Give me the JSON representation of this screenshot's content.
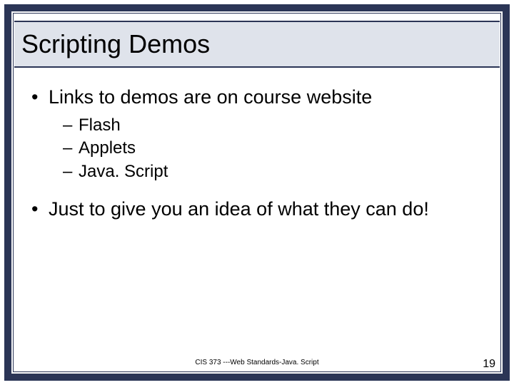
{
  "slide": {
    "title": "Scripting Demos",
    "bullets": [
      {
        "level": 1,
        "text": "Links to demos are on course website"
      },
      {
        "level": 2,
        "text": "Flash"
      },
      {
        "level": 2,
        "text": "Applets"
      },
      {
        "level": 2,
        "text": "Java. Script"
      },
      {
        "level": 0,
        "text": ""
      },
      {
        "level": 1,
        "text": "Just to give you an idea of what they can do!"
      }
    ],
    "footer": "CIS 373 ---Web Standards-Java. Script",
    "page_number": "19"
  }
}
